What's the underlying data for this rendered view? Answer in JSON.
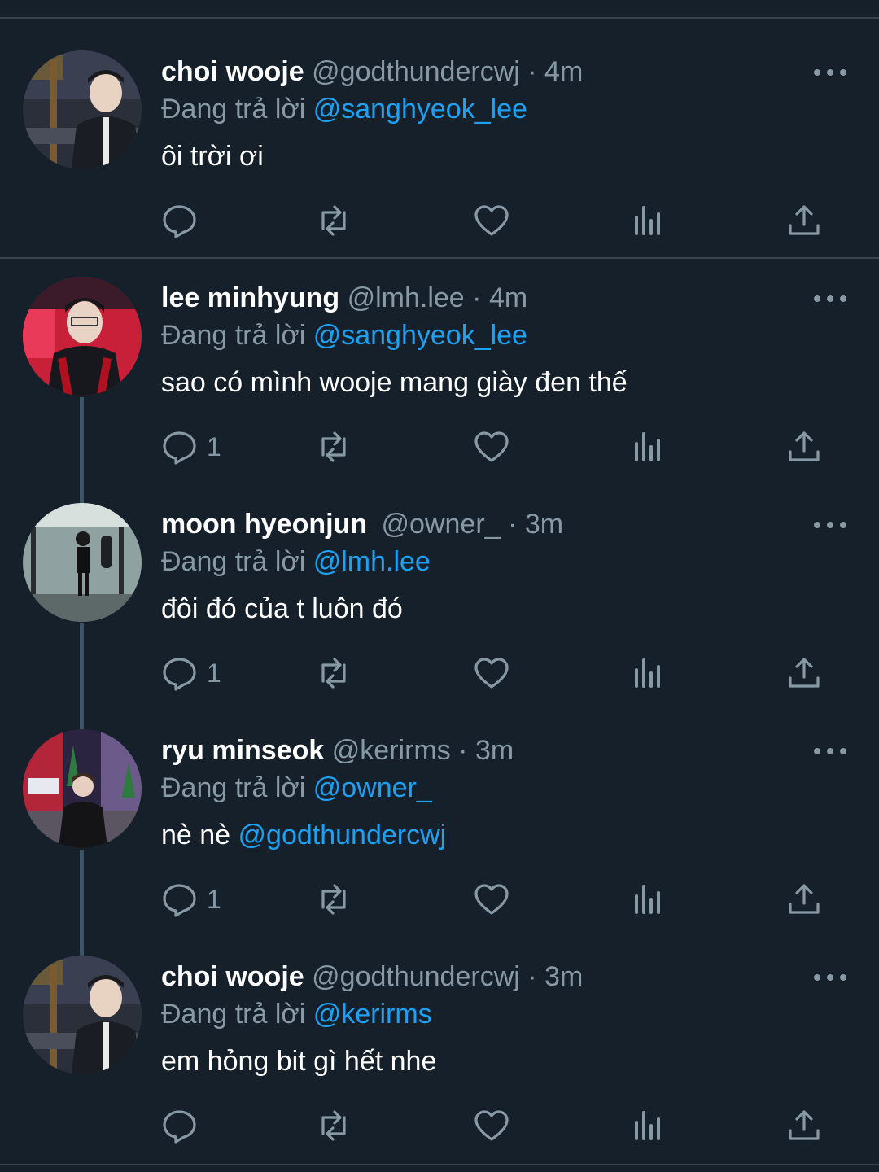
{
  "colors": {
    "background": "#15202b",
    "accent": "#1da1f2",
    "muted": "#8899a6",
    "divider": "#38444d"
  },
  "reply_prefix": "Đang trả lời",
  "tweets": [
    {
      "name": "choi wooje",
      "handle": "@godthundercwj",
      "dot": "·",
      "time": "4m",
      "reply_to": "@sanghyeok_lee",
      "text": "ôi trời ơi",
      "text_mention": "",
      "reply_count": "",
      "avatar": "avatar-choi-wooje"
    },
    {
      "name": "lee minhyung",
      "handle": "@lmh.lee",
      "dot": "·",
      "time": "4m",
      "reply_to": "@sanghyeok_lee",
      "text": "sao có mình wooje mang giày đen thế",
      "text_mention": "",
      "reply_count": "1",
      "avatar": "avatar-lee-minhyung"
    },
    {
      "name": "moon hyeonjun",
      "handle": "@owner_",
      "dot": "·",
      "time": "3m",
      "reply_to": "@lmh.lee",
      "text": "đôi đó của t luôn đó",
      "text_mention": "",
      "reply_count": "1",
      "avatar": "avatar-moon-hyeonjun"
    },
    {
      "name": "ryu minseok",
      "handle": "@kerirms",
      "dot": "·",
      "time": "3m",
      "reply_to": "@owner_",
      "text": "nè nè ",
      "text_mention": "@godthundercwj",
      "reply_count": "1",
      "avatar": "avatar-ryu-minseok"
    },
    {
      "name": "choi wooje",
      "handle": "@godthundercwj",
      "dot": "·",
      "time": "3m",
      "reply_to": "@kerirms",
      "text": "em hỏng bit gì hết nhe",
      "text_mention": "",
      "reply_count": "",
      "avatar": "avatar-choi-wooje"
    }
  ],
  "icons": {
    "reply": "reply-icon",
    "retweet": "retweet-icon",
    "like": "like-icon",
    "analytics": "analytics-icon",
    "share": "share-icon",
    "more": "more-icon"
  }
}
